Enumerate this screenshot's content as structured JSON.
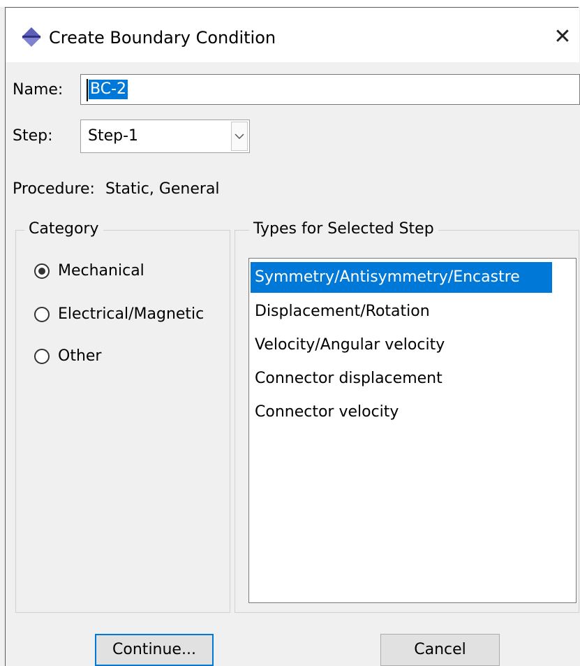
{
  "window": {
    "title": "Create Boundary Condition",
    "close_glyph": "✕"
  },
  "name": {
    "label": "Name:",
    "value": "BC-2"
  },
  "step": {
    "label": "Step:",
    "value": "Step-1"
  },
  "procedure": {
    "label": "Procedure:",
    "value": "Static, General"
  },
  "category": {
    "title": "Category",
    "options": [
      {
        "label": "Mechanical",
        "checked": true
      },
      {
        "label": "Electrical/Magnetic",
        "checked": false
      },
      {
        "label": "Other",
        "checked": false
      }
    ]
  },
  "types": {
    "title": "Types for Selected Step",
    "items": [
      {
        "label": "Symmetry/Antisymmetry/Encastre",
        "selected": true
      },
      {
        "label": "Displacement/Rotation",
        "selected": false
      },
      {
        "label": "Velocity/Angular velocity",
        "selected": false
      },
      {
        "label": "Connector displacement",
        "selected": false
      },
      {
        "label": "Connector velocity",
        "selected": false
      }
    ]
  },
  "buttons": {
    "continue": "Continue...",
    "cancel": "Cancel"
  },
  "colors": {
    "selection": "#0078d7",
    "window_bg": "#f0f0f0",
    "icon": "#5b5fb8"
  },
  "icons": {
    "app": "abaqus-bc-icon",
    "close": "close-icon",
    "dropdown": "chevron-down-icon"
  }
}
